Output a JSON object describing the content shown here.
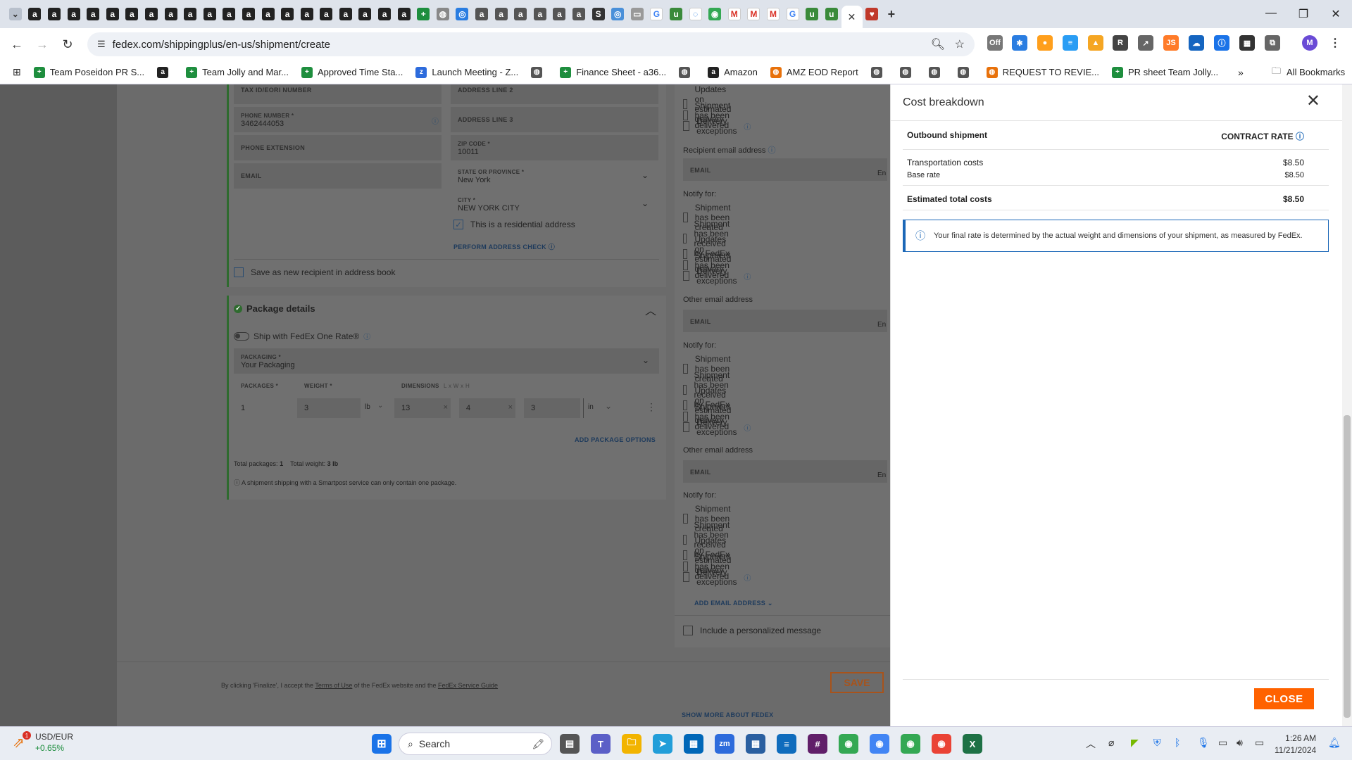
{
  "browser": {
    "url": "fedex.com/shippingplus/en-us/shipment/create",
    "tab_icons": [
      "amazon-tab-icon",
      "amazon-tab-icon",
      "amazon-tab-icon",
      "amazon-tab-icon",
      "amazon-tab-icon",
      "amazon-tab-icon",
      "amazon-tab-icon",
      "amazon-tab-icon",
      "amazon-tab-icon",
      "amazon-tab-icon",
      "amazon-tab-icon",
      "amazon-tab-icon",
      "amazon-tab-icon",
      "amazon-tab-icon",
      "amazon-tab-icon",
      "amazon-tab-icon",
      "amazon-tab-icon",
      "amazon-tab-icon",
      "amazon-tab-icon",
      "amazon-tab-icon"
    ],
    "bookmarks": [
      {
        "label": "Team Poseidon PR S...",
        "icon": "sheets-icon",
        "color": "#1e8e3e"
      },
      {
        "label": "",
        "icon": "amazon-icon",
        "color": "#222"
      },
      {
        "label": "Team Jolly and Mar...",
        "icon": "sheets-icon",
        "color": "#1e8e3e"
      },
      {
        "label": "Approved Time Sta...",
        "icon": "sheets-icon",
        "color": "#1e8e3e"
      },
      {
        "label": "Launch Meeting - Z...",
        "icon": "zoom-icon",
        "color": "#2d6bdc"
      },
      {
        "label": "",
        "icon": "globe-icon",
        "color": "#555"
      },
      {
        "label": "Finance Sheet - a36...",
        "icon": "sheets-icon",
        "color": "#1e8e3e"
      },
      {
        "label": "",
        "icon": "globe-icon",
        "color": "#555"
      },
      {
        "label": "Amazon",
        "icon": "amazon-icon",
        "color": "#222"
      },
      {
        "label": "AMZ EOD Report",
        "icon": "report-icon",
        "color": "#e8710a"
      },
      {
        "label": "",
        "icon": "globe-icon",
        "color": "#555"
      },
      {
        "label": "",
        "icon": "globe-icon",
        "color": "#555"
      },
      {
        "label": "",
        "icon": "globe-icon",
        "color": "#555"
      },
      {
        "label": "",
        "icon": "globe-icon",
        "color": "#555"
      },
      {
        "label": "REQUEST TO REVIE...",
        "icon": "report-icon",
        "color": "#e8710a"
      },
      {
        "label": "PR sheet Team Jolly...",
        "icon": "sheets-icon",
        "color": "#1e8e3e"
      }
    ],
    "all_bookmarks": "All Bookmarks",
    "profile_initial": "M"
  },
  "form": {
    "tax_id_label": "TAX ID/EORI NUMBER",
    "address2_label": "ADDRESS LINE 2",
    "phone_label": "PHONE NUMBER *",
    "phone_value": "3462444053",
    "address3_label": "ADDRESS LINE 3",
    "ext_label": "PHONE EXTENSION",
    "zip_label": "ZIP CODE *",
    "zip_value": "10011",
    "email_label": "EMAIL",
    "state_label": "STATE OR PROVINCE *",
    "state_value": "New York",
    "city_label": "CITY *",
    "city_value": "NEW YORK CITY",
    "residential": "This is a residential address",
    "address_check": "PERFORM ADDRESS CHECK",
    "save_recipient": "Save as new recipient in address book",
    "package_title": "Package details",
    "one_rate": "Ship with FedEx One Rate®",
    "packaging_label": "PACKAGING *",
    "packaging_value": "Your Packaging",
    "packages_label": "PACKAGES *",
    "packages_value": "1",
    "weight_label": "WEIGHT *",
    "weight_value": "3",
    "weight_unit": "lb",
    "dimensions_label": "DIMENSIONS",
    "dimensions_hint": "L x W x H",
    "dim_l": "13",
    "dim_w": "4",
    "dim_h": "3",
    "dim_unit": "in",
    "add_package_options": "ADD PACKAGE OPTIONS",
    "total_packages_label": "Total packages:",
    "total_packages_value": "1",
    "total_weight_label": "Total weight:",
    "total_weight_value": "3 lb",
    "smartpost_note": "A shipment shipping with a Smartpost service can only contain one package.",
    "terms_prefix": "By clicking 'Finalize', I accept the",
    "terms_link": "Terms of Use",
    "terms_middle": "of the FedEx website and the",
    "terms_link2": "FedEx Service Guide",
    "save_button": "SAVE",
    "show_more": "SHOW MORE ABOUT FEDEX"
  },
  "notifications": {
    "recipient_email_label": "Recipient email address",
    "other_email_label": "Other email address",
    "email_field": "EMAIL",
    "lang_field_partial": "En",
    "notify_for": "Notify for:",
    "options": [
      "Shipment has been created",
      "Shipment has been received by FedEx",
      "Updates on estimated delivery",
      "Shipment has been delivered",
      "Delivery exceptions"
    ],
    "top_options": [
      "Updates on estimated delivery",
      "Shipment has been delivered",
      "Delivery exceptions"
    ],
    "add_email": "ADD EMAIL ADDRESS",
    "personal_message": "Include a personalized message"
  },
  "cost_panel": {
    "title": "Cost breakdown",
    "outbound": "Outbound shipment",
    "contract_rate": "CONTRACT RATE",
    "transport_label": "Transportation costs",
    "transport_value": "$8.50",
    "base_label": "Base rate",
    "base_value": "$8.50",
    "total_label": "Estimated total costs",
    "total_value": "$8.50",
    "info_text": "Your final rate is determined by the actual weight and dimensions of your shipment, as measured by FedEx.",
    "close_button": "CLOSE"
  },
  "taskbar": {
    "ticker_name": "USD/EUR",
    "ticker_change": "+0.65%",
    "ticker_badge": "1",
    "search_placeholder": "Search",
    "time": "1:26 AM",
    "date": "11/21/2024"
  }
}
